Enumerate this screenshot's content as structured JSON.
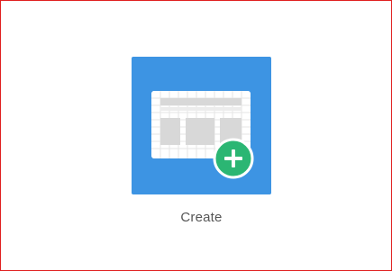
{
  "create_tile": {
    "label": "Create",
    "tile_color": "#3d94e3",
    "badge_color": "#2bb673",
    "icon": "spreadsheet-icon",
    "badge_icon": "plus-icon"
  },
  "colors": {
    "frame_border": "#e02020",
    "text": "#555555"
  }
}
